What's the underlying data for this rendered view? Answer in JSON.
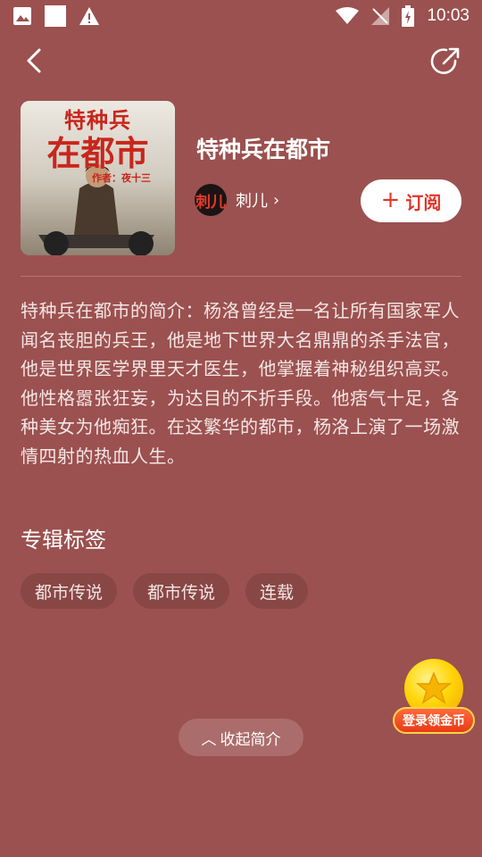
{
  "status_bar": {
    "time": "10:03",
    "icons": [
      "image-icon",
      "square-icon",
      "warning-icon",
      "wifi-icon",
      "no-signal-icon",
      "battery-charging-icon"
    ]
  },
  "header": {
    "back_icon": "chevron-left-icon",
    "share_icon": "share-icon"
  },
  "book": {
    "title": "特种兵在都市",
    "author": "刺儿",
    "author_chevron": "›",
    "subscribe_plus": "+",
    "subscribe_label": "订阅",
    "cover": {
      "title_line1": "特种兵",
      "title_line2": "在都市",
      "author_line": "作者：夜十三"
    },
    "avatar_text": "刺儿"
  },
  "synopsis": "特种兵在都市的简介：杨洛曾经是一名让所有国家军人闻名丧胆的兵王，他是地下世界大名鼎鼎的杀手法官，他是世界医学界里天才医生，他掌握着神秘组织高买。他性格嚣张狂妄，为达目的不折手段。他痞气十足，各种美女为他痴狂。在这繁华的都市，杨洛上演了一场激情四射的热血人生。",
  "tags": {
    "title": "专辑标签",
    "items": [
      "都市传说",
      "都市传说",
      "连载"
    ]
  },
  "coin_widget": {
    "label": "登录领金币"
  },
  "collapse": {
    "arrow": "︿",
    "label": "收起简介"
  },
  "colors": {
    "background": "#9b514f",
    "accent": "#e0352b"
  }
}
